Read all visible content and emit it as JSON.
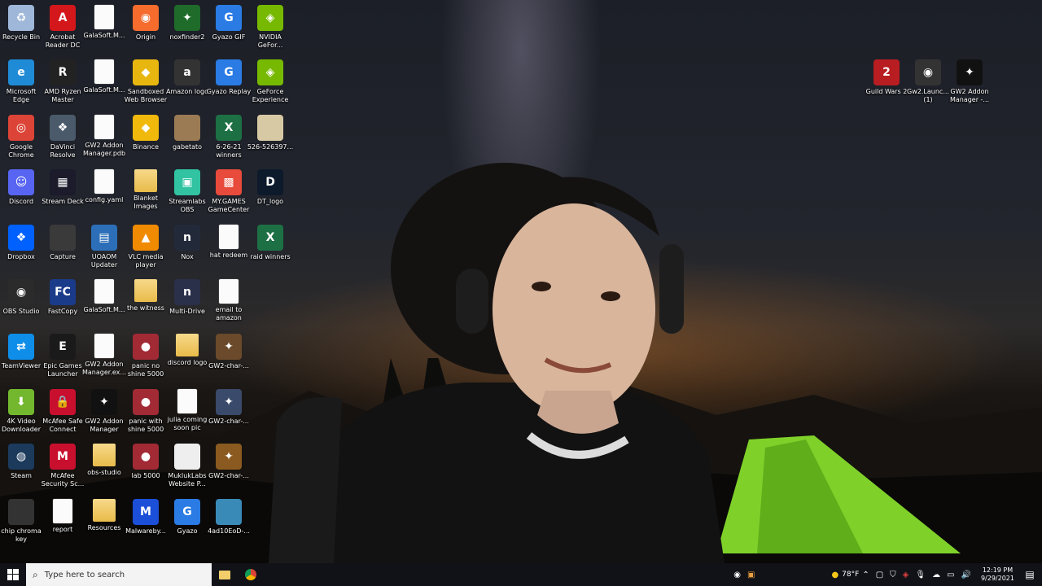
{
  "desktop_icons_left": [
    {
      "label": "Recycle Bin",
      "icon": "recycle-bin-icon",
      "color": "#9fb7d8",
      "glyph": "♻"
    },
    {
      "label": "Acrobat\nReader DC",
      "icon": "acrobat-icon",
      "color": "#d4171b",
      "glyph": "A"
    },
    {
      "label": "GalaSoft.M...",
      "icon": "file-icon",
      "color": "#ffffff",
      "glyph": ""
    },
    {
      "label": "Origin",
      "icon": "origin-icon",
      "color": "#f56c2d",
      "glyph": "◉"
    },
    {
      "label": "noxfinder2",
      "icon": "image-icon",
      "color": "#1f6b2a",
      "glyph": "✦"
    },
    {
      "label": "Gyazo GIF",
      "icon": "gyazo-gif-icon",
      "color": "#2a7be4",
      "glyph": "G"
    },
    {
      "label": "NVIDIA\nGeFor...",
      "icon": "nvidia-icon",
      "color": "#76b900",
      "glyph": "◈"
    },
    {
      "label": "Microsoft\nEdge",
      "icon": "edge-icon",
      "color": "#1f8bd6",
      "glyph": "e"
    },
    {
      "label": "AMD Ryzen\nMaster",
      "icon": "ryzen-icon",
      "color": "#222222",
      "glyph": "R"
    },
    {
      "label": "GalaSoft.M...",
      "icon": "file-icon",
      "color": "#ffffff",
      "glyph": ""
    },
    {
      "label": "Sandboxed\nWeb Browser",
      "icon": "sandbox-icon",
      "color": "#e8b70f",
      "glyph": "◆"
    },
    {
      "label": "Amazon logo",
      "icon": "amazon-icon",
      "color": "#333333",
      "glyph": "a"
    },
    {
      "label": "Gyazo Replay",
      "icon": "gyazo-replay-icon",
      "color": "#2a7be4",
      "glyph": "G"
    },
    {
      "label": "GeForce\nExperience",
      "icon": "geforce-icon",
      "color": "#76b900",
      "glyph": "◈"
    },
    {
      "label": "Google\nChrome",
      "icon": "chrome-icon",
      "color": "#db4437",
      "glyph": "◎"
    },
    {
      "label": "DaVinci\nResolve",
      "icon": "davinci-icon",
      "color": "#4a5a6a",
      "glyph": "❖"
    },
    {
      "label": "GW2 Addon\nManager.pdb",
      "icon": "file-icon",
      "color": "#ffffff",
      "glyph": ""
    },
    {
      "label": "Binance",
      "icon": "binance-icon",
      "color": "#f0b90b",
      "glyph": "◆"
    },
    {
      "label": "gabetato",
      "icon": "image-icon",
      "color": "#9b7b53",
      "glyph": ""
    },
    {
      "label": "6-26-21\nwinners",
      "icon": "excel-icon",
      "color": "#1d7044",
      "glyph": "X"
    },
    {
      "label": "526-526397...",
      "icon": "image-icon",
      "color": "#d8c9a5",
      "glyph": ""
    },
    {
      "label": "Discord",
      "icon": "discord-icon",
      "color": "#5865f2",
      "glyph": "☺"
    },
    {
      "label": "Stream Deck",
      "icon": "streamdeck-icon",
      "color": "#1b1b2b",
      "glyph": "▦"
    },
    {
      "label": "config.yaml",
      "icon": "file-icon",
      "color": "#ffffff",
      "glyph": ""
    },
    {
      "label": "Blanket\nImages",
      "icon": "folder-icon",
      "color": "#f2cd6a",
      "glyph": ""
    },
    {
      "label": "Streamlabs\nOBS",
      "icon": "streamlabs-icon",
      "color": "#31c3a2",
      "glyph": "▣"
    },
    {
      "label": "MY.GAMES\nGameCenter",
      "icon": "mygames-icon",
      "color": "#e84a3b",
      "glyph": "▩"
    },
    {
      "label": "DT_logo",
      "icon": "image-icon",
      "color": "#0d1a2b",
      "glyph": "D"
    },
    {
      "label": "Dropbox",
      "icon": "dropbox-icon",
      "color": "#0061ff",
      "glyph": "❖"
    },
    {
      "label": "Capture",
      "icon": "image-icon",
      "color": "#3a3a3a",
      "glyph": ""
    },
    {
      "label": "UOAOM\nUpdater",
      "icon": "uoaom-icon",
      "color": "#2c6fb8",
      "glyph": "▤"
    },
    {
      "label": "VLC media\nplayer",
      "icon": "vlc-icon",
      "color": "#f08a00",
      "glyph": "▲"
    },
    {
      "label": "Nox",
      "icon": "nox-icon",
      "color": "#222a3a",
      "glyph": "n"
    },
    {
      "label": "hat redeem",
      "icon": "file-icon",
      "color": "#ffffff",
      "glyph": ""
    },
    {
      "label": "raid winners",
      "icon": "excel-icon",
      "color": "#1d7044",
      "glyph": "X"
    },
    {
      "label": "OBS Studio",
      "icon": "obs-icon",
      "color": "#2b2b2b",
      "glyph": "◉"
    },
    {
      "label": "FastCopy",
      "icon": "fastcopy-icon",
      "color": "#1a3a8a",
      "glyph": "FC"
    },
    {
      "label": "GalaSoft.M...",
      "icon": "file-icon",
      "color": "#ffffff",
      "glyph": ""
    },
    {
      "label": "the witness",
      "icon": "folder-icon",
      "color": "#f2cd6a",
      "glyph": ""
    },
    {
      "label": "Multi-Drive",
      "icon": "multidrive-icon",
      "color": "#2a2f4a",
      "glyph": "n"
    },
    {
      "label": "email to\namazon",
      "icon": "file-icon",
      "color": "#ffffff",
      "glyph": ""
    },
    {
      "label": "TeamViewer",
      "icon": "teamviewer-icon",
      "color": "#0e8ee9",
      "glyph": "⇄"
    },
    {
      "label": "Epic Games\nLauncher",
      "icon": "epic-icon",
      "color": "#1a1a1a",
      "glyph": "E"
    },
    {
      "label": "GW2 Addon\nManager.ex...",
      "icon": "file-icon",
      "color": "#ffffff",
      "glyph": ""
    },
    {
      "label": "panic no\nshine 5000",
      "icon": "panic-icon",
      "color": "#a12a35",
      "glyph": "●"
    },
    {
      "label": "discord logo",
      "icon": "folder-icon",
      "color": "#f2cd6a",
      "glyph": ""
    },
    {
      "label": "GW2-char-...",
      "icon": "image-icon",
      "color": "#6a4a2a",
      "glyph": "✦"
    },
    {
      "label": "4K Video\nDownloader",
      "icon": "4kvideo-icon",
      "color": "#73b72e",
      "glyph": "⬇"
    },
    {
      "label": "McAfee Safe\nConnect",
      "icon": "mcafee-safe-icon",
      "color": "#c8102e",
      "glyph": "🔒"
    },
    {
      "label": "GW2 Addon\nManager",
      "icon": "gw2-addon-icon",
      "color": "#111111",
      "glyph": "✦"
    },
    {
      "label": "panic with\nshine 5000",
      "icon": "panic-icon",
      "color": "#a12a35",
      "glyph": "●"
    },
    {
      "label": "julia coming\nsoon pic",
      "icon": "file-icon",
      "color": "#ffffff",
      "glyph": ""
    },
    {
      "label": "GW2-char-...",
      "icon": "image-icon",
      "color": "#3a4a6a",
      "glyph": "✦"
    },
    {
      "label": "Steam",
      "icon": "steam-icon",
      "color": "#1b3a5c",
      "glyph": "◍"
    },
    {
      "label": "McAfee\nSecurity Sc...",
      "icon": "mcafee-icon",
      "color": "#c8102e",
      "glyph": "M"
    },
    {
      "label": "obs-studio",
      "icon": "folder-icon",
      "color": "#f2cd6a",
      "glyph": ""
    },
    {
      "label": "lab 5000",
      "icon": "panic-icon",
      "color": "#a12a35",
      "glyph": "●"
    },
    {
      "label": "MuklukLabs\nWebsite P...",
      "icon": "image-icon",
      "color": "#eeeeee",
      "glyph": ""
    },
    {
      "label": "GW2-char-...",
      "icon": "image-icon",
      "color": "#8a5a20",
      "glyph": "✦"
    },
    {
      "label": "chip chroma\nkey",
      "icon": "image-icon",
      "color": "#333333",
      "glyph": ""
    },
    {
      "label": "report",
      "icon": "file-icon",
      "color": "#ffffff",
      "glyph": ""
    },
    {
      "label": "Resources",
      "icon": "folder-icon",
      "color": "#f2cd6a",
      "glyph": ""
    },
    {
      "label": "Malwareby...",
      "icon": "malwarebytes-icon",
      "color": "#1b4fd8",
      "glyph": "M"
    },
    {
      "label": "Gyazo",
      "icon": "gyazo-icon",
      "color": "#2a7be4",
      "glyph": "G"
    },
    {
      "label": "4ad10EoD-...",
      "icon": "image-icon",
      "color": "#3a8ab8",
      "glyph": ""
    }
  ],
  "desktop_icons_right": [
    {
      "label": "Guild Wars 2",
      "icon": "guild-wars-icon",
      "color": "#b81d22",
      "glyph": "2"
    },
    {
      "label": "Gw2.Launc...\n(1)",
      "icon": "gw2-launcher-icon",
      "color": "#333333",
      "glyph": "◉"
    },
    {
      "label": "GW2 Addon\nManager -...",
      "icon": "gw2-addon-icon",
      "color": "#111111",
      "glyph": "✦"
    }
  ],
  "taskbar": {
    "search_placeholder": "Type here to search",
    "weather": "78°F",
    "time": "12:19 PM",
    "date": "9/29/2021"
  }
}
